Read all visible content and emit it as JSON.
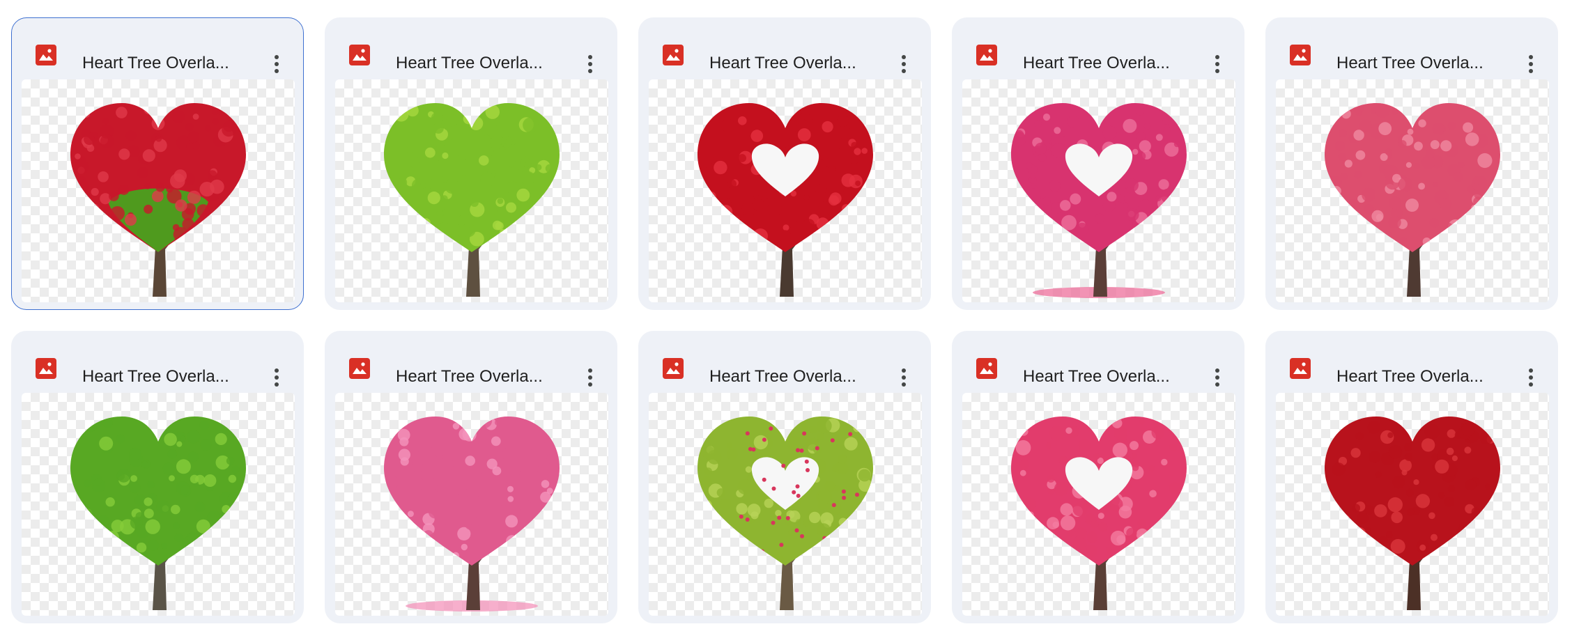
{
  "files": [
    {
      "name": "Heart Tree Overla...",
      "selected": true,
      "variant": "split",
      "leaf": "#c8182a",
      "leaf2": "#4f9a1e",
      "highlight": "#e0394a",
      "trunk": "#5a4636"
    },
    {
      "name": "Heart Tree Overla...",
      "selected": false,
      "variant": "solid",
      "leaf": "#7cbf28",
      "highlight": "#a6d83e",
      "trunk": "#5e5040"
    },
    {
      "name": "Heart Tree Overla...",
      "selected": false,
      "variant": "hollow",
      "leaf": "#c4101e",
      "highlight": "#e5303e",
      "trunk": "#4a3a30"
    },
    {
      "name": "Heart Tree Overla...",
      "selected": false,
      "variant": "hollow-ground",
      "leaf": "#d8336f",
      "highlight": "#ee6f9b",
      "trunk": "#5b3f38"
    },
    {
      "name": "Heart Tree Overla...",
      "selected": false,
      "variant": "solid",
      "leaf": "#dd4e6e",
      "highlight": "#f08aa0",
      "trunk": "#4f3a32"
    },
    {
      "name": "Heart Tree Overla...",
      "selected": false,
      "variant": "solid",
      "leaf": "#58a823",
      "highlight": "#86cc3a",
      "trunk": "#5a5448"
    },
    {
      "name": "Heart Tree Overla...",
      "selected": false,
      "variant": "solid-ground",
      "leaf": "#e05a8e",
      "highlight": "#f494bb",
      "trunk": "#5b3f38"
    },
    {
      "name": "Heart Tree Overla...",
      "selected": false,
      "variant": "hollow-dots",
      "leaf": "#8eb530",
      "highlight": "#b8d358",
      "trunk": "#6a5a44"
    },
    {
      "name": "Heart Tree Overla...",
      "selected": false,
      "variant": "hollow",
      "leaf": "#e23c6c",
      "highlight": "#f47ca0",
      "trunk": "#5a3f36"
    },
    {
      "name": "Heart Tree Overla...",
      "selected": false,
      "variant": "solid",
      "leaf": "#b8121c",
      "highlight": "#d9363c",
      "trunk": "#4c3026"
    }
  ],
  "icons": {
    "file_type": "image-icon",
    "menu": "more-vert-icon"
  },
  "colors": {
    "file_icon_red": "#d93025",
    "card_bg": "#eef1f7",
    "selected_border": "#3d6fd0"
  }
}
